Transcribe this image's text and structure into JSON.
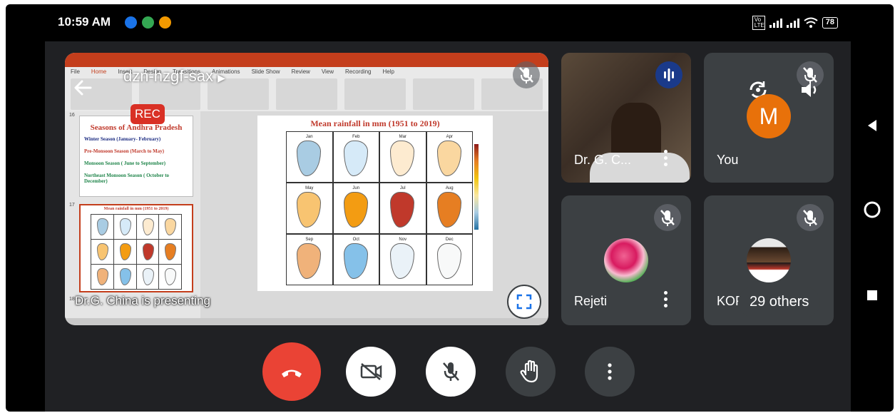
{
  "status_bar": {
    "time": "10:59 AM",
    "battery": "78",
    "volte": "Vo LTE"
  },
  "meeting": {
    "code": "dzn-hzgf-sax",
    "rec_label": "REC",
    "presenting_text": "Dr.G. China is presenting"
  },
  "slide": {
    "thumb_title": "Seasons of Andhra Pradesh",
    "seasons": [
      {
        "text": "Winter Season (January- February)",
        "color": "#1a2a80"
      },
      {
        "text": "Pre-Monsoon Season (March to May)",
        "color": "#c0392b"
      },
      {
        "text": "Monsoon Season ( June to September)",
        "color": "#1e8449"
      },
      {
        "text": "Northeast Monsoon Season ( October to December)",
        "color": "#1e8449"
      }
    ],
    "thumb_num_16": "16",
    "thumb_num_17": "17",
    "thumb_num_18": "18",
    "thumb2_title": "Mean rainfall in mm (1951 to 2019)",
    "main_title": "Mean rainfall in mm (1951 to 2019)",
    "months": [
      "Jan",
      "Feb",
      "Mar",
      "Apr",
      "May",
      "Jun",
      "Jul",
      "Aug",
      "Sep",
      "Oct",
      "Nov",
      "Dec"
    ],
    "month_colors": [
      "#a9cce3",
      "#d6eaf8",
      "#fdebd0",
      "#fad7a0",
      "#f8c471",
      "#f39c12",
      "#c0392b",
      "#e67e22",
      "#f0b27a",
      "#85c1e9",
      "#eaf2f8",
      "#f8f9f9"
    ],
    "ribbon_tabs": [
      "File",
      "Home",
      "Insert",
      "Design",
      "Transitions",
      "Animations",
      "Slide Show",
      "Review",
      "View",
      "Recording",
      "Help"
    ]
  },
  "participants": [
    {
      "name": "Dr. G. C...",
      "type": "video"
    },
    {
      "name": "You",
      "initial": "M",
      "avatar_color": "#e8710a"
    },
    {
      "name": "Rejeti",
      "type": "photo"
    },
    {
      "name": "KOP",
      "others_label": "29 others"
    }
  ],
  "colors": {
    "end_call": "#ea4335",
    "control_bg": "#3c4043",
    "tile_bg": "#3c4043",
    "screen_bg": "#202124"
  }
}
